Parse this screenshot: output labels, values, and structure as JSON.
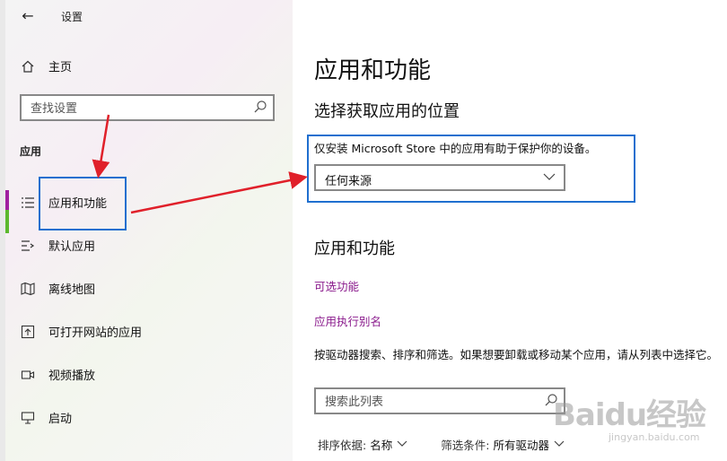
{
  "window": {
    "title": "设置"
  },
  "sidebar": {
    "home_label": "主页",
    "search_placeholder": "查找设置",
    "section_label": "应用",
    "items": [
      {
        "label": "应用和功能",
        "icon": "list-icon",
        "selected": true
      },
      {
        "label": "默认应用",
        "icon": "default-apps-icon"
      },
      {
        "label": "离线地图",
        "icon": "map-icon"
      },
      {
        "label": "可打开网站的应用",
        "icon": "open-in-app-icon"
      },
      {
        "label": "视频播放",
        "icon": "video-icon"
      },
      {
        "label": "启动",
        "icon": "startup-icon"
      }
    ]
  },
  "main": {
    "title": "应用和功能",
    "choose_title": "选择获取应用的位置",
    "choose_desc": "仅安装 Microsoft Store 中的应用有助于保护你的设备。",
    "source_value": "任何来源",
    "apps_heading": "应用和功能",
    "link_optional": "可选功能",
    "link_alias": "应用执行别名",
    "body": "按驱动器搜索、排序和筛选。如果想要卸载或移动某个应用，请从列表中选择它。",
    "list_search_placeholder": "搜索此列表",
    "sort_label": "排序依据:",
    "sort_value": "名称",
    "filter_label": "筛选条件:",
    "filter_value": "所有驱动器"
  },
  "watermark": {
    "brand": "Baidu经验",
    "url": "jingyan.baidu.com"
  },
  "colors": {
    "accent": "#8a1a8c",
    "highlight": "#1f6fcf",
    "annotation": "#e0202a"
  }
}
